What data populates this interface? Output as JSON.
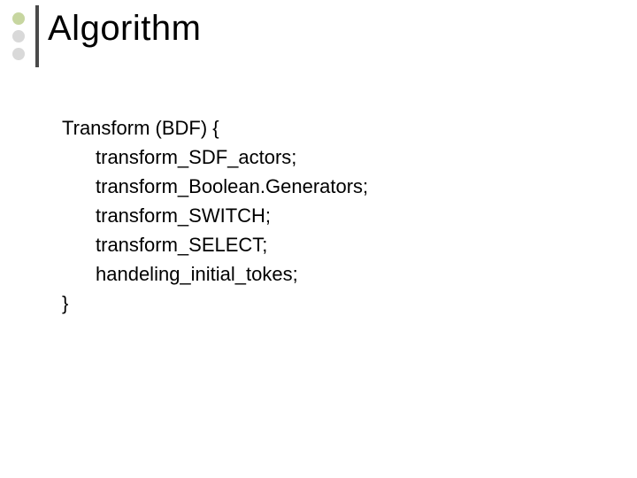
{
  "title": "Algorithm",
  "bullet_colors": [
    "#c7d6a0",
    "#d9d9d9",
    "#d9d9d9"
  ],
  "rule_color": "#4a4a4a",
  "code": {
    "open": "Transform (BDF) {",
    "lines": [
      "transform_SDF_actors;",
      "transform_Boolean.Generators;",
      "transform_SWITCH;",
      "transform_SELECT;",
      "handeling_initial_tokes;"
    ],
    "close": "}"
  }
}
